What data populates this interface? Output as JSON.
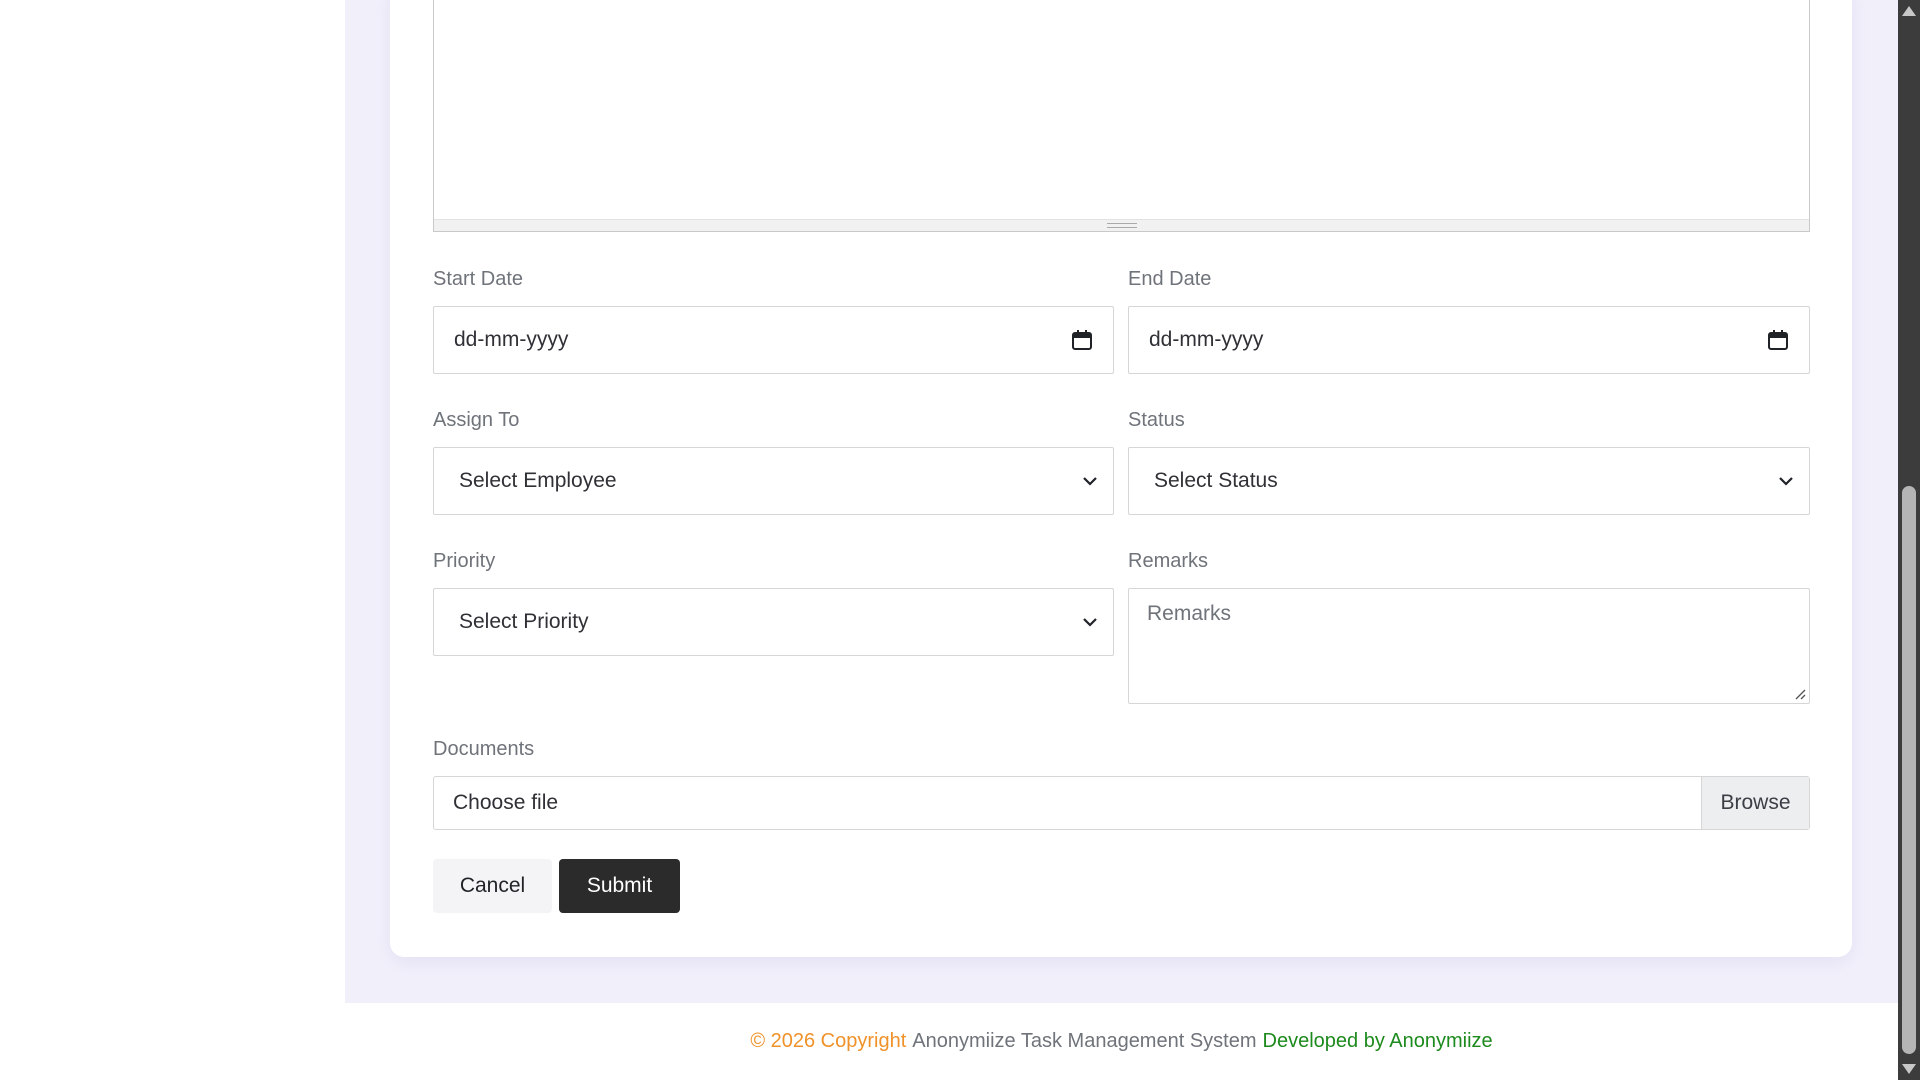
{
  "form": {
    "start_date": {
      "label": "Start Date",
      "placeholder": "dd-mm-yyyy"
    },
    "end_date": {
      "label": "End Date",
      "placeholder": "dd-mm-yyyy"
    },
    "assign_to": {
      "label": "Assign To",
      "selected": "Select Employee"
    },
    "status": {
      "label": "Status",
      "selected": "Select Status"
    },
    "priority": {
      "label": "Priority",
      "selected": "Select Priority"
    },
    "remarks": {
      "label": "Remarks",
      "placeholder": "Remarks"
    },
    "documents": {
      "label": "Documents",
      "file_text": "Choose file",
      "browse_label": "Browse"
    },
    "cancel_label": "Cancel",
    "submit_label": "Submit"
  },
  "footer": {
    "copyright": "© 2026 Copyright",
    "system_name": "Anonymiize Task Management System",
    "developed_by": "Developed by Anonymiize"
  },
  "colors": {
    "content_bg": "#f1f0fa",
    "submit_bg": "#2b2b2b",
    "footer_copyright": "#f0922a",
    "footer_developer": "#1d8a1d"
  },
  "icons": {
    "date": "calendar-icon",
    "select": "chevron-down-icon"
  }
}
